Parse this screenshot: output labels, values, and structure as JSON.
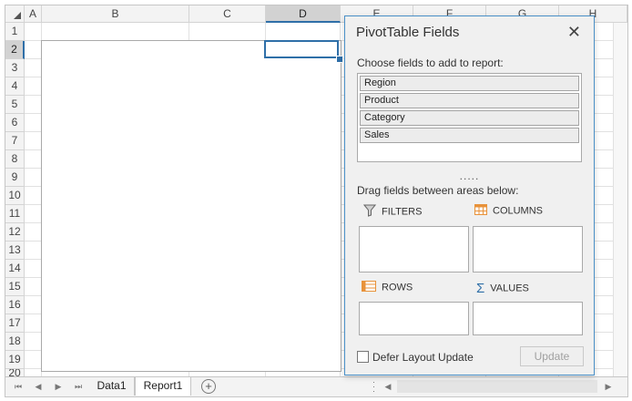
{
  "columns": [
    "A",
    "B",
    "C",
    "D",
    "E",
    "F",
    "G",
    "H"
  ],
  "selected_column": "D",
  "rows": [
    "1",
    "2",
    "3",
    "4",
    "5",
    "6",
    "7",
    "8",
    "9",
    "10",
    "11",
    "12",
    "13",
    "14",
    "15",
    "16",
    "17",
    "18",
    "19",
    "20"
  ],
  "selected_row": "2",
  "sheet_tabs": [
    {
      "label": "Data1",
      "active": false
    },
    {
      "label": "Report1",
      "active": true
    }
  ],
  "add_sheet_label": "+",
  "panel": {
    "title": "PivotTable Fields",
    "close_glyph": "✕",
    "choose_label": "Choose fields to add to report:",
    "fields": [
      "Region",
      "Product",
      "Category",
      "Sales"
    ],
    "splitter": ".....",
    "drag_label": "Drag fields between areas below:",
    "areas": {
      "filters": "FILTERS",
      "columns": "COLUMNS",
      "rows": "ROWS",
      "values": "VALUES"
    },
    "defer_label": "Defer Layout Update",
    "defer_checked": false,
    "update_label": "Update"
  },
  "colors": {
    "accent": "#2f6fa8",
    "panel_border": "#4a90c8",
    "icon_orange": "#e8923a",
    "icon_blue": "#2f6fa8"
  }
}
